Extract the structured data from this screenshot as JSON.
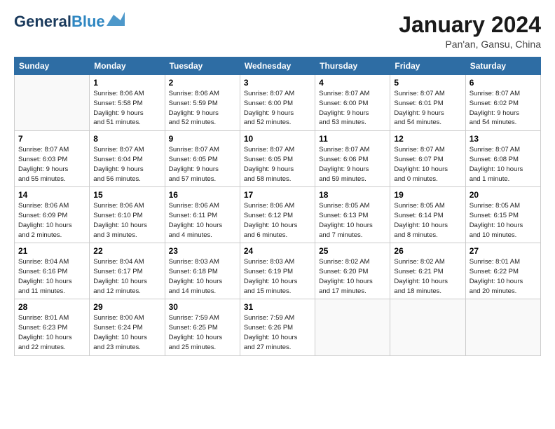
{
  "header": {
    "logo_line1": "General",
    "logo_line2": "Blue",
    "month": "January 2024",
    "location": "Pan'an, Gansu, China"
  },
  "weekdays": [
    "Sunday",
    "Monday",
    "Tuesday",
    "Wednesday",
    "Thursday",
    "Friday",
    "Saturday"
  ],
  "weeks": [
    [
      {
        "day": "",
        "info": ""
      },
      {
        "day": "1",
        "info": "Sunrise: 8:06 AM\nSunset: 5:58 PM\nDaylight: 9 hours\nand 51 minutes."
      },
      {
        "day": "2",
        "info": "Sunrise: 8:06 AM\nSunset: 5:59 PM\nDaylight: 9 hours\nand 52 minutes."
      },
      {
        "day": "3",
        "info": "Sunrise: 8:07 AM\nSunset: 6:00 PM\nDaylight: 9 hours\nand 52 minutes."
      },
      {
        "day": "4",
        "info": "Sunrise: 8:07 AM\nSunset: 6:00 PM\nDaylight: 9 hours\nand 53 minutes."
      },
      {
        "day": "5",
        "info": "Sunrise: 8:07 AM\nSunset: 6:01 PM\nDaylight: 9 hours\nand 54 minutes."
      },
      {
        "day": "6",
        "info": "Sunrise: 8:07 AM\nSunset: 6:02 PM\nDaylight: 9 hours\nand 54 minutes."
      }
    ],
    [
      {
        "day": "7",
        "info": "Sunrise: 8:07 AM\nSunset: 6:03 PM\nDaylight: 9 hours\nand 55 minutes."
      },
      {
        "day": "8",
        "info": "Sunrise: 8:07 AM\nSunset: 6:04 PM\nDaylight: 9 hours\nand 56 minutes."
      },
      {
        "day": "9",
        "info": "Sunrise: 8:07 AM\nSunset: 6:05 PM\nDaylight: 9 hours\nand 57 minutes."
      },
      {
        "day": "10",
        "info": "Sunrise: 8:07 AM\nSunset: 6:05 PM\nDaylight: 9 hours\nand 58 minutes."
      },
      {
        "day": "11",
        "info": "Sunrise: 8:07 AM\nSunset: 6:06 PM\nDaylight: 9 hours\nand 59 minutes."
      },
      {
        "day": "12",
        "info": "Sunrise: 8:07 AM\nSunset: 6:07 PM\nDaylight: 10 hours\nand 0 minutes."
      },
      {
        "day": "13",
        "info": "Sunrise: 8:07 AM\nSunset: 6:08 PM\nDaylight: 10 hours\nand 1 minute."
      }
    ],
    [
      {
        "day": "14",
        "info": "Sunrise: 8:06 AM\nSunset: 6:09 PM\nDaylight: 10 hours\nand 2 minutes."
      },
      {
        "day": "15",
        "info": "Sunrise: 8:06 AM\nSunset: 6:10 PM\nDaylight: 10 hours\nand 3 minutes."
      },
      {
        "day": "16",
        "info": "Sunrise: 8:06 AM\nSunset: 6:11 PM\nDaylight: 10 hours\nand 4 minutes."
      },
      {
        "day": "17",
        "info": "Sunrise: 8:06 AM\nSunset: 6:12 PM\nDaylight: 10 hours\nand 6 minutes."
      },
      {
        "day": "18",
        "info": "Sunrise: 8:05 AM\nSunset: 6:13 PM\nDaylight: 10 hours\nand 7 minutes."
      },
      {
        "day": "19",
        "info": "Sunrise: 8:05 AM\nSunset: 6:14 PM\nDaylight: 10 hours\nand 8 minutes."
      },
      {
        "day": "20",
        "info": "Sunrise: 8:05 AM\nSunset: 6:15 PM\nDaylight: 10 hours\nand 10 minutes."
      }
    ],
    [
      {
        "day": "21",
        "info": "Sunrise: 8:04 AM\nSunset: 6:16 PM\nDaylight: 10 hours\nand 11 minutes."
      },
      {
        "day": "22",
        "info": "Sunrise: 8:04 AM\nSunset: 6:17 PM\nDaylight: 10 hours\nand 12 minutes."
      },
      {
        "day": "23",
        "info": "Sunrise: 8:03 AM\nSunset: 6:18 PM\nDaylight: 10 hours\nand 14 minutes."
      },
      {
        "day": "24",
        "info": "Sunrise: 8:03 AM\nSunset: 6:19 PM\nDaylight: 10 hours\nand 15 minutes."
      },
      {
        "day": "25",
        "info": "Sunrise: 8:02 AM\nSunset: 6:20 PM\nDaylight: 10 hours\nand 17 minutes."
      },
      {
        "day": "26",
        "info": "Sunrise: 8:02 AM\nSunset: 6:21 PM\nDaylight: 10 hours\nand 18 minutes."
      },
      {
        "day": "27",
        "info": "Sunrise: 8:01 AM\nSunset: 6:22 PM\nDaylight: 10 hours\nand 20 minutes."
      }
    ],
    [
      {
        "day": "28",
        "info": "Sunrise: 8:01 AM\nSunset: 6:23 PM\nDaylight: 10 hours\nand 22 minutes."
      },
      {
        "day": "29",
        "info": "Sunrise: 8:00 AM\nSunset: 6:24 PM\nDaylight: 10 hours\nand 23 minutes."
      },
      {
        "day": "30",
        "info": "Sunrise: 7:59 AM\nSunset: 6:25 PM\nDaylight: 10 hours\nand 25 minutes."
      },
      {
        "day": "31",
        "info": "Sunrise: 7:59 AM\nSunset: 6:26 PM\nDaylight: 10 hours\nand 27 minutes."
      },
      {
        "day": "",
        "info": ""
      },
      {
        "day": "",
        "info": ""
      },
      {
        "day": "",
        "info": ""
      }
    ]
  ]
}
